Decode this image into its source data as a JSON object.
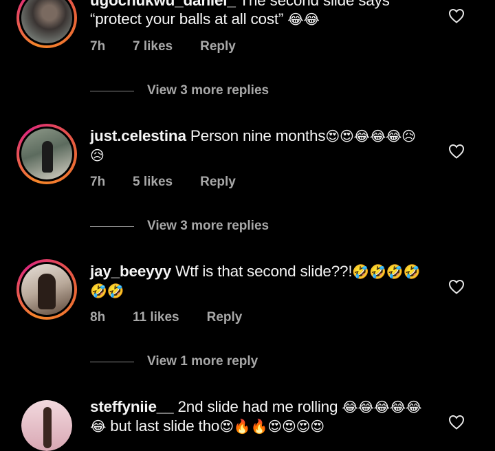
{
  "comments": [
    {
      "username": "ugochukwu_daniel_",
      "text": "The second slide says “protect your balls at all cost”",
      "emoji": "😂😂",
      "time": "7h",
      "likes": "7 likes",
      "reply_label": "Reply",
      "view_replies": "View 3 more replies",
      "avatar_icon": "profile-photo"
    },
    {
      "username": "just.celestina",
      "text": "Person nine months",
      "emoji": "😍😍😂😂😂😥😥",
      "time": "7h",
      "likes": "5 likes",
      "reply_label": "Reply",
      "view_replies": "View 3 more replies",
      "avatar_icon": "profile-photo"
    },
    {
      "username": "jay_beeyyy",
      "text": "Wtf is that second slide??!",
      "emoji": "🤣🤣🤣🤣🤣🤣",
      "time": "8h",
      "likes": "11 likes",
      "reply_label": "Reply",
      "view_replies": "View 1 more reply",
      "avatar_icon": "profile-photo"
    },
    {
      "username": "steffyniie__",
      "text": "2nd slide had me rolling",
      "emoji": "😂😂😂😂😂😂",
      "text2": "but last slide tho",
      "emoji2": "😍🔥🔥😍😍😍😍",
      "avatar_icon": "profile-photo"
    }
  ],
  "colors": {
    "background": "#000000",
    "text": "#f5f5f5",
    "muted": "#a8a8a8",
    "story_ring_start": "#f58529",
    "story_ring_end": "#dd2a7b"
  },
  "icons": {
    "like": "heart-outline-icon"
  }
}
